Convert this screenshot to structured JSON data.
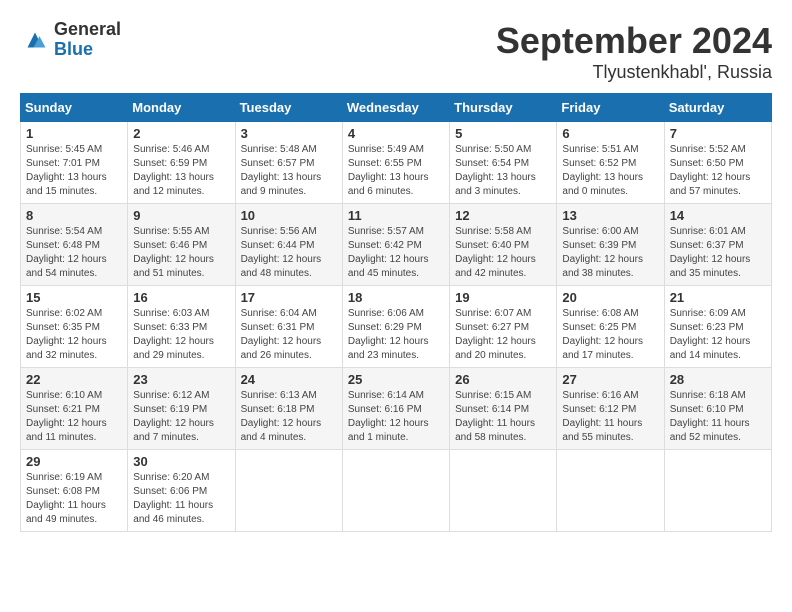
{
  "logo": {
    "general": "General",
    "blue": "Blue"
  },
  "title": "September 2024",
  "subtitle": "Tlyustenkhabl', Russia",
  "weekdays": [
    "Sunday",
    "Monday",
    "Tuesday",
    "Wednesday",
    "Thursday",
    "Friday",
    "Saturday"
  ],
  "weeks": [
    [
      {
        "day": "1",
        "info": "Sunrise: 5:45 AM\nSunset: 7:01 PM\nDaylight: 13 hours\nand 15 minutes."
      },
      {
        "day": "2",
        "info": "Sunrise: 5:46 AM\nSunset: 6:59 PM\nDaylight: 13 hours\nand 12 minutes."
      },
      {
        "day": "3",
        "info": "Sunrise: 5:48 AM\nSunset: 6:57 PM\nDaylight: 13 hours\nand 9 minutes."
      },
      {
        "day": "4",
        "info": "Sunrise: 5:49 AM\nSunset: 6:55 PM\nDaylight: 13 hours\nand 6 minutes."
      },
      {
        "day": "5",
        "info": "Sunrise: 5:50 AM\nSunset: 6:54 PM\nDaylight: 13 hours\nand 3 minutes."
      },
      {
        "day": "6",
        "info": "Sunrise: 5:51 AM\nSunset: 6:52 PM\nDaylight: 13 hours\nand 0 minutes."
      },
      {
        "day": "7",
        "info": "Sunrise: 5:52 AM\nSunset: 6:50 PM\nDaylight: 12 hours\nand 57 minutes."
      }
    ],
    [
      {
        "day": "8",
        "info": "Sunrise: 5:54 AM\nSunset: 6:48 PM\nDaylight: 12 hours\nand 54 minutes."
      },
      {
        "day": "9",
        "info": "Sunrise: 5:55 AM\nSunset: 6:46 PM\nDaylight: 12 hours\nand 51 minutes."
      },
      {
        "day": "10",
        "info": "Sunrise: 5:56 AM\nSunset: 6:44 PM\nDaylight: 12 hours\nand 48 minutes."
      },
      {
        "day": "11",
        "info": "Sunrise: 5:57 AM\nSunset: 6:42 PM\nDaylight: 12 hours\nand 45 minutes."
      },
      {
        "day": "12",
        "info": "Sunrise: 5:58 AM\nSunset: 6:40 PM\nDaylight: 12 hours\nand 42 minutes."
      },
      {
        "day": "13",
        "info": "Sunrise: 6:00 AM\nSunset: 6:39 PM\nDaylight: 12 hours\nand 38 minutes."
      },
      {
        "day": "14",
        "info": "Sunrise: 6:01 AM\nSunset: 6:37 PM\nDaylight: 12 hours\nand 35 minutes."
      }
    ],
    [
      {
        "day": "15",
        "info": "Sunrise: 6:02 AM\nSunset: 6:35 PM\nDaylight: 12 hours\nand 32 minutes."
      },
      {
        "day": "16",
        "info": "Sunrise: 6:03 AM\nSunset: 6:33 PM\nDaylight: 12 hours\nand 29 minutes."
      },
      {
        "day": "17",
        "info": "Sunrise: 6:04 AM\nSunset: 6:31 PM\nDaylight: 12 hours\nand 26 minutes."
      },
      {
        "day": "18",
        "info": "Sunrise: 6:06 AM\nSunset: 6:29 PM\nDaylight: 12 hours\nand 23 minutes."
      },
      {
        "day": "19",
        "info": "Sunrise: 6:07 AM\nSunset: 6:27 PM\nDaylight: 12 hours\nand 20 minutes."
      },
      {
        "day": "20",
        "info": "Sunrise: 6:08 AM\nSunset: 6:25 PM\nDaylight: 12 hours\nand 17 minutes."
      },
      {
        "day": "21",
        "info": "Sunrise: 6:09 AM\nSunset: 6:23 PM\nDaylight: 12 hours\nand 14 minutes."
      }
    ],
    [
      {
        "day": "22",
        "info": "Sunrise: 6:10 AM\nSunset: 6:21 PM\nDaylight: 12 hours\nand 11 minutes."
      },
      {
        "day": "23",
        "info": "Sunrise: 6:12 AM\nSunset: 6:19 PM\nDaylight: 12 hours\nand 7 minutes."
      },
      {
        "day": "24",
        "info": "Sunrise: 6:13 AM\nSunset: 6:18 PM\nDaylight: 12 hours\nand 4 minutes."
      },
      {
        "day": "25",
        "info": "Sunrise: 6:14 AM\nSunset: 6:16 PM\nDaylight: 12 hours\nand 1 minute."
      },
      {
        "day": "26",
        "info": "Sunrise: 6:15 AM\nSunset: 6:14 PM\nDaylight: 11 hours\nand 58 minutes."
      },
      {
        "day": "27",
        "info": "Sunrise: 6:16 AM\nSunset: 6:12 PM\nDaylight: 11 hours\nand 55 minutes."
      },
      {
        "day": "28",
        "info": "Sunrise: 6:18 AM\nSunset: 6:10 PM\nDaylight: 11 hours\nand 52 minutes."
      }
    ],
    [
      {
        "day": "29",
        "info": "Sunrise: 6:19 AM\nSunset: 6:08 PM\nDaylight: 11 hours\nand 49 minutes."
      },
      {
        "day": "30",
        "info": "Sunrise: 6:20 AM\nSunset: 6:06 PM\nDaylight: 11 hours\nand 46 minutes."
      },
      {
        "day": "",
        "info": ""
      },
      {
        "day": "",
        "info": ""
      },
      {
        "day": "",
        "info": ""
      },
      {
        "day": "",
        "info": ""
      },
      {
        "day": "",
        "info": ""
      }
    ]
  ]
}
